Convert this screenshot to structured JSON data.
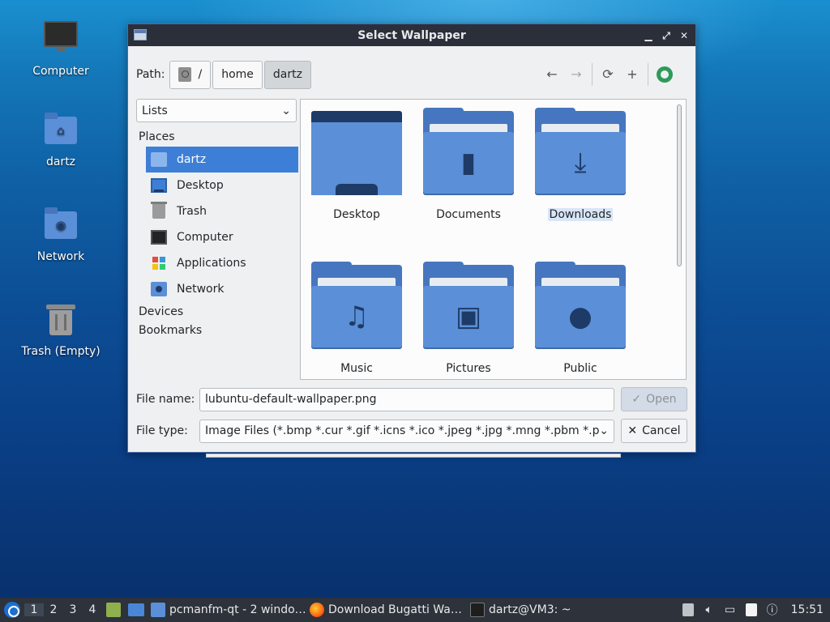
{
  "desktop": {
    "icons": [
      {
        "label": "Computer",
        "icon": "computer-icon"
      },
      {
        "label": "dartz",
        "icon": "home-folder-icon"
      },
      {
        "label": "Network",
        "icon": "network-folder-icon"
      },
      {
        "label": "Trash (Empty)",
        "icon": "trash-icon"
      }
    ]
  },
  "dialog": {
    "title": "Select Wallpaper",
    "titlebar_buttons": {
      "minimize": "▁",
      "maximize": "⤢",
      "close": "✕"
    },
    "path_label": "Path:",
    "breadcrumbs": [
      "/",
      "home",
      "dartz"
    ],
    "nav": {
      "back": "←",
      "forward": "→",
      "reload": "⟳",
      "new_folder": "+"
    },
    "sidebar": {
      "combo_value": "Lists",
      "places_header": "Places",
      "places": [
        {
          "label": "dartz",
          "icon": "home-folder-icon",
          "selected": true
        },
        {
          "label": "Desktop",
          "icon": "desktop-icon"
        },
        {
          "label": "Trash",
          "icon": "trash-icon"
        },
        {
          "label": "Computer",
          "icon": "computer-icon"
        },
        {
          "label": "Applications",
          "icon": "applications-icon"
        },
        {
          "label": "Network",
          "icon": "network-icon"
        }
      ],
      "devices_header": "Devices",
      "bookmarks_header": "Bookmarks"
    },
    "files": [
      {
        "label": "Desktop",
        "icon": "desktop-folder-icon"
      },
      {
        "label": "Documents",
        "icon": "documents-folder-icon",
        "glyph": "▮"
      },
      {
        "label": "Downloads",
        "icon": "downloads-folder-icon",
        "glyph": "⤓",
        "highlighted": true
      },
      {
        "label": "Music",
        "icon": "music-folder-icon",
        "glyph": "♫"
      },
      {
        "label": "Pictures",
        "icon": "pictures-folder-icon",
        "glyph": "▣"
      },
      {
        "label": "Public",
        "icon": "public-folder-icon",
        "glyph": "●"
      }
    ],
    "filename_label": "File name:",
    "filename_value": "lubuntu-default-wallpaper.png",
    "filetype_label": "File type:",
    "filetype_value": "Image Files (*.bmp *.cur *.gif *.icns *.ico *.jpeg *.jpg *.mng *.pbm *.pgm",
    "open_button": "Open",
    "cancel_button": "Cancel"
  },
  "taskbar": {
    "workspaces": [
      "1",
      "2",
      "3",
      "4"
    ],
    "tasks": [
      {
        "label": "pcmanfm-qt - 2 windo…",
        "icon": "folder-icon"
      },
      {
        "label": "Download Bugatti Wa…",
        "icon": "firefox-icon"
      },
      {
        "label": "dartz@VM3: ~",
        "icon": "terminal-icon"
      }
    ],
    "clock": "15:51"
  },
  "colors": {
    "accent": "#3d7fd6",
    "folder": "#5b8fd8",
    "titlebar": "#2a2f3a",
    "taskbar": "#2d323b"
  }
}
